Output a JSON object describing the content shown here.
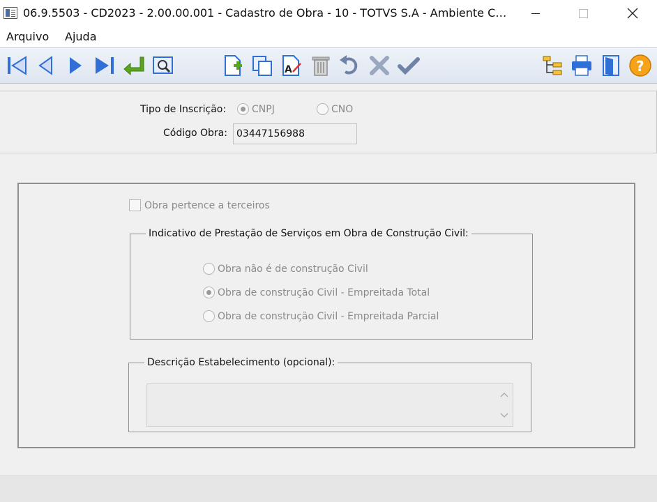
{
  "window": {
    "title": "06.9.5503 - CD2023 - 2.00.00.001 - Cadastro de Obra - 10 - TOTVS S.A - Ambiente Co..."
  },
  "menu": {
    "arquivo": "Arquivo",
    "ajuda": "Ajuda"
  },
  "toolbar": {
    "icons": [
      "first-record-icon",
      "previous-record-icon",
      "next-record-icon",
      "last-record-icon",
      "select-enter-icon",
      "search-zoom-icon",
      "new-record-icon",
      "copy-record-icon",
      "edit-record-icon",
      "delete-record-icon",
      "undo-icon",
      "cancel-icon",
      "confirm-icon",
      "tree-view-icon",
      "print-icon",
      "exit-door-icon",
      "help-icon"
    ]
  },
  "header": {
    "tipo_label": "Tipo de Inscrição:",
    "tipo_options": [
      {
        "label": "CNPJ",
        "selected": true
      },
      {
        "label": "CNO",
        "selected": false
      }
    ],
    "codigo_label": "Código Obra:",
    "codigo_value": "03447156988"
  },
  "main": {
    "terceiros_label": "Obra pertence a terceiros",
    "terceiros_checked": false,
    "indicativo": {
      "legend": "Indicativo de Prestação de Serviços em Obra de Construção Civil:",
      "options": [
        {
          "label": "Obra não é de construção Civil",
          "selected": false
        },
        {
          "label": "Obra de construção Civil - Empreitada Total",
          "selected": true
        },
        {
          "label": "Obra de construção Civil - Empreitada Parcial",
          "selected": false
        }
      ]
    },
    "descricao": {
      "legend": "Descrição Estabelecimento (opcional):",
      "value": ""
    }
  },
  "colors": {
    "toolbar_blue": "#2f6fd6",
    "toolbar_green": "#5aa51e",
    "help_orange": "#f6a21a",
    "disabled_text": "#8a8a8a"
  }
}
